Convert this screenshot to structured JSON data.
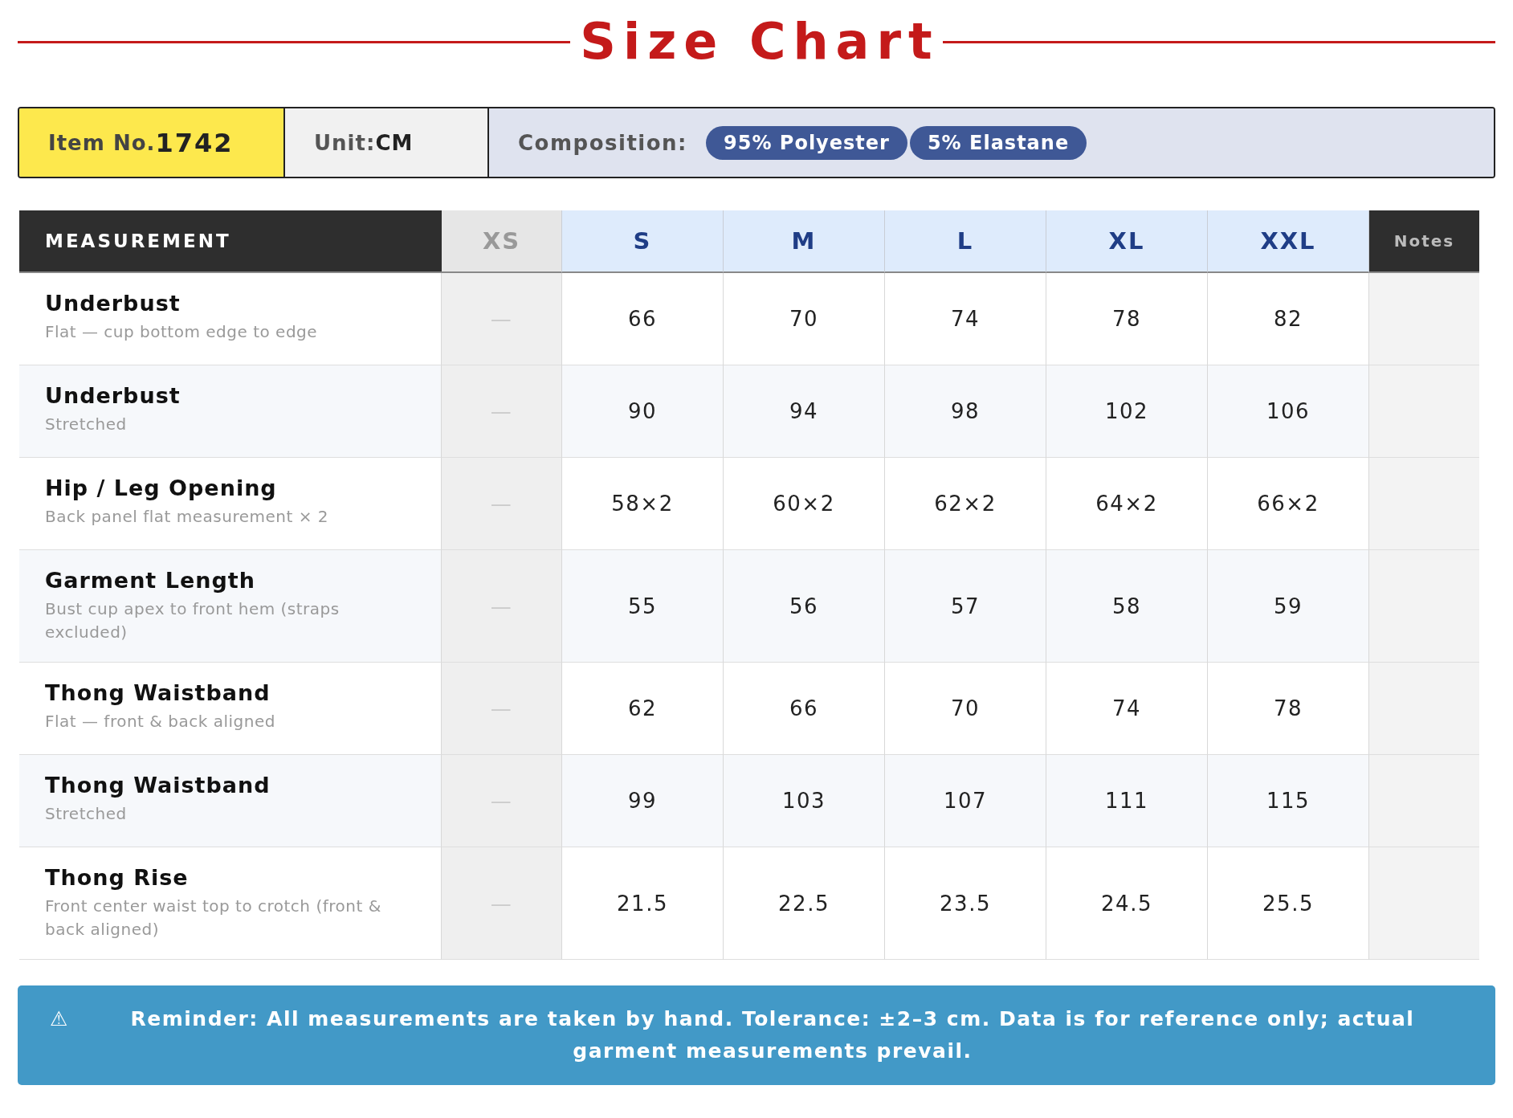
{
  "title": "Size Chart",
  "info_bar": {
    "item_label": "Item No.",
    "item_number": "1742",
    "unit_label": "Unit:",
    "unit": "CM",
    "composition_label": "Composition:",
    "materials": [
      "95% Polyester",
      "5% Elastane"
    ]
  },
  "table": {
    "measurement_header": "MEASUREMENT",
    "notes_header": "Notes",
    "sizes": [
      {
        "label": "XS",
        "available": false
      },
      {
        "label": "S",
        "available": true
      },
      {
        "label": "M",
        "available": true
      },
      {
        "label": "L",
        "available": true
      },
      {
        "label": "XL",
        "available": true
      },
      {
        "label": "XXL",
        "available": true
      }
    ],
    "rows": [
      {
        "name": "Underbust",
        "detail": "Flat — cup bottom edge to edge",
        "values": [
          "—",
          "66",
          "70",
          "74",
          "78",
          "82"
        ]
      },
      {
        "name": "Underbust",
        "detail": "Stretched",
        "values": [
          "—",
          "90",
          "94",
          "98",
          "102",
          "106"
        ]
      },
      {
        "name": "Hip / Leg Opening",
        "detail": "Back panel flat measurement × 2",
        "values": [
          "—",
          "58×2",
          "60×2",
          "62×2",
          "64×2",
          "66×2"
        ]
      },
      {
        "name": "Garment Length",
        "detail": "Bust cup apex to front hem (straps excluded)",
        "values": [
          "—",
          "55",
          "56",
          "57",
          "58",
          "59"
        ]
      },
      {
        "name": "Thong Waistband",
        "detail": "Flat — front & back aligned",
        "values": [
          "—",
          "62",
          "66",
          "70",
          "74",
          "78"
        ]
      },
      {
        "name": "Thong Waistband",
        "detail": "Stretched",
        "values": [
          "—",
          "99",
          "103",
          "107",
          "111",
          "115"
        ]
      },
      {
        "name": "Thong Rise",
        "detail": "Front center waist top to crotch (front & back aligned)",
        "values": [
          "—",
          "21.5",
          "22.5",
          "23.5",
          "24.5",
          "25.5"
        ]
      }
    ]
  },
  "reminder": {
    "icon": "⚠",
    "text": "Reminder: All measurements are taken by hand. Tolerance: ±2–3 cm. Data is for reference only; actual garment measurements prevail."
  }
}
